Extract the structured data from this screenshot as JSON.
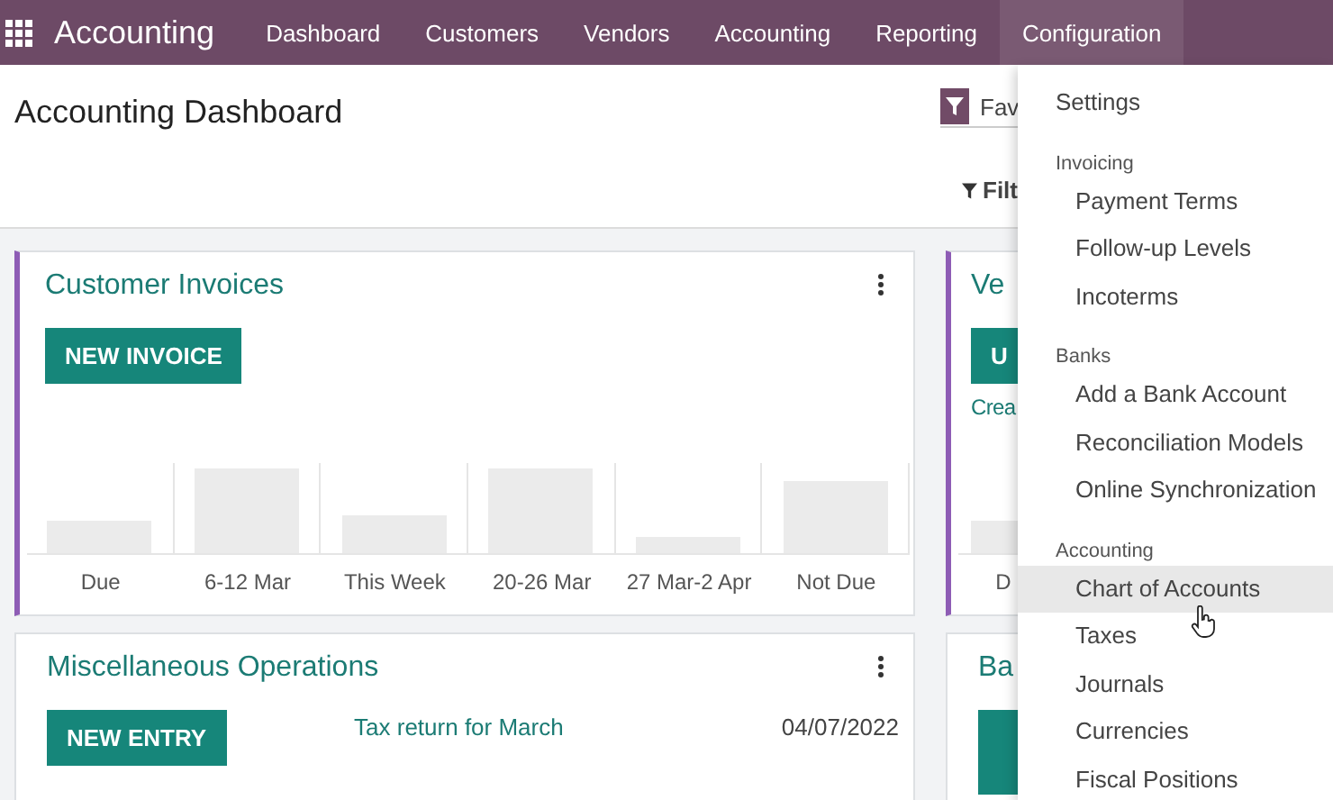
{
  "navbar": {
    "app_name": "Accounting",
    "menu": [
      {
        "label": "Dashboard",
        "selected": false
      },
      {
        "label": "Customers",
        "selected": false
      },
      {
        "label": "Vendors",
        "selected": false
      },
      {
        "label": "Accounting",
        "selected": false
      },
      {
        "label": "Reporting",
        "selected": false
      },
      {
        "label": "Configuration",
        "selected": true
      }
    ]
  },
  "page": {
    "title": "Accounting Dashboard",
    "search_facet": "Fav",
    "filter_button": "Filt"
  },
  "cards": [
    {
      "kind": "chart",
      "title": "Customer Invoices",
      "button": "NEW INVOICE",
      "chart_labels": [
        "Due",
        "6-12 Mar",
        "This Week",
        "20-26 Mar",
        "27 Mar-2 Apr",
        "Not Due"
      ]
    },
    {
      "kind": "entry",
      "title": "Miscellaneous Operations",
      "button": "NEW ENTRY",
      "entry_link": "Tax return for March",
      "entry_date": "04/07/2022"
    }
  ],
  "side_cards": [
    {
      "kind": "chart",
      "title": "Ve",
      "button": "U",
      "link": "Crea",
      "chart_labels": [
        "D"
      ]
    },
    {
      "kind": "plain",
      "title": "Ba"
    }
  ],
  "dropdown": {
    "items": [
      {
        "kind": "item",
        "label": "Settings",
        "hovered": false
      },
      {
        "kind": "header",
        "label": "Invoicing"
      },
      {
        "kind": "subitem",
        "label": "Payment Terms",
        "hovered": false
      },
      {
        "kind": "subitem",
        "label": "Follow-up Levels",
        "hovered": false
      },
      {
        "kind": "subitem",
        "label": "Incoterms",
        "hovered": false
      },
      {
        "kind": "header",
        "label": "Banks"
      },
      {
        "kind": "subitem",
        "label": "Add a Bank Account",
        "hovered": false
      },
      {
        "kind": "subitem",
        "label": "Reconciliation Models",
        "hovered": false
      },
      {
        "kind": "subitem",
        "label": "Online Synchronization",
        "hovered": false
      },
      {
        "kind": "header",
        "label": "Accounting"
      },
      {
        "kind": "subitem",
        "label": "Chart of Accounts",
        "hovered": true
      },
      {
        "kind": "subitem",
        "label": "Taxes",
        "hovered": false
      },
      {
        "kind": "subitem",
        "label": "Journals",
        "hovered": false
      },
      {
        "kind": "subitem",
        "label": "Currencies",
        "hovered": false
      },
      {
        "kind": "subitem",
        "label": "Fiscal Positions",
        "hovered": false
      }
    ]
  }
}
